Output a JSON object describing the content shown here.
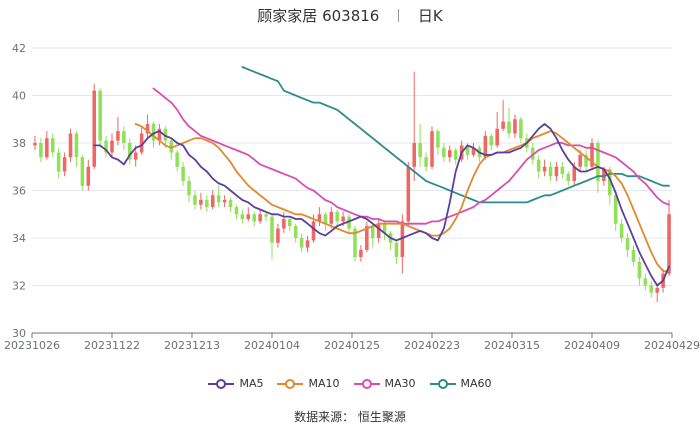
{
  "header": {
    "name": "顾家家居",
    "code": "603816",
    "period": "日K"
  },
  "source": "数据来源： 恒生聚源",
  "colors": {
    "up": "#ee6666",
    "down": "#91e158",
    "grid": "#e4e7ee",
    "axis": "#6e7079"
  },
  "chart_data": {
    "type": "candlestick",
    "ylim": [
      30,
      42
    ],
    "yticks": [
      30,
      32,
      34,
      36,
      38,
      40,
      42
    ],
    "xticks": [
      "20231026",
      "20231122",
      "20231213",
      "20240104",
      "20240125",
      "20240223",
      "20240315",
      "20240409",
      "20240429"
    ],
    "legend": [
      {
        "name": "MA5",
        "color": "#5b3f9a"
      },
      {
        "name": "MA10",
        "color": "#e08a2e"
      },
      {
        "name": "MA30",
        "color": "#d84fb0"
      },
      {
        "name": "MA60",
        "color": "#2e8b8b"
      }
    ],
    "candles": [
      [
        37.9,
        38.0,
        38.3,
        37.7
      ],
      [
        38.0,
        37.4,
        38.2,
        37.2
      ],
      [
        37.4,
        38.2,
        38.5,
        37.3
      ],
      [
        38.2,
        37.6,
        38.4,
        37.4
      ],
      [
        37.6,
        36.8,
        37.8,
        36.5
      ],
      [
        36.8,
        37.4,
        37.6,
        36.6
      ],
      [
        37.4,
        38.4,
        38.6,
        37.2
      ],
      [
        38.4,
        37.4,
        38.5,
        37.0
      ],
      [
        37.4,
        36.2,
        37.5,
        36.0
      ],
      [
        36.2,
        37.0,
        37.3,
        36.0
      ],
      [
        37.0,
        40.2,
        40.5,
        36.9
      ],
      [
        40.2,
        38.1,
        40.3,
        37.8
      ],
      [
        38.1,
        37.6,
        38.3,
        37.4
      ],
      [
        37.6,
        38.1,
        38.4,
        37.4
      ],
      [
        38.1,
        38.5,
        39.1,
        37.9
      ],
      [
        38.5,
        38.0,
        38.7,
        37.7
      ],
      [
        38.0,
        37.3,
        38.2,
        37.1
      ],
      [
        37.3,
        37.6,
        37.9,
        37.0
      ],
      [
        37.6,
        38.4,
        38.7,
        37.5
      ],
      [
        38.4,
        38.8,
        39.2,
        38.2
      ],
      [
        38.8,
        38.1,
        38.9,
        37.8
      ],
      [
        38.1,
        38.6,
        38.8,
        37.9
      ],
      [
        38.6,
        38.1,
        38.7,
        37.8
      ],
      [
        38.1,
        37.6,
        38.2,
        37.3
      ],
      [
        37.6,
        37.0,
        37.7,
        36.8
      ],
      [
        37.0,
        36.4,
        37.2,
        36.2
      ],
      [
        36.4,
        35.8,
        36.6,
        35.5
      ],
      [
        35.8,
        35.4,
        36.0,
        35.2
      ],
      [
        35.4,
        35.6,
        35.9,
        35.2
      ],
      [
        35.6,
        35.3,
        35.8,
        35.1
      ],
      [
        35.3,
        35.8,
        36.0,
        35.2
      ],
      [
        35.8,
        35.5,
        36.2,
        35.3
      ],
      [
        35.5,
        35.6,
        35.8,
        35.3
      ],
      [
        35.6,
        35.3,
        35.7,
        35.1
      ],
      [
        35.3,
        35.0,
        35.4,
        34.8
      ],
      [
        35.0,
        34.8,
        35.2,
        34.6
      ],
      [
        34.8,
        35.0,
        35.3,
        34.7
      ],
      [
        35.0,
        34.7,
        35.1,
        34.5
      ],
      [
        34.7,
        35.0,
        35.2,
        34.6
      ],
      [
        35.0,
        34.9,
        35.1,
        34.7
      ],
      [
        34.9,
        33.8,
        35.0,
        33.1
      ],
      [
        33.8,
        34.4,
        34.6,
        33.6
      ],
      [
        34.4,
        34.8,
        35.1,
        34.2
      ],
      [
        34.8,
        34.5,
        34.9,
        34.3
      ],
      [
        34.5,
        34.0,
        34.6,
        33.8
      ],
      [
        34.0,
        33.6,
        34.2,
        33.4
      ],
      [
        33.6,
        33.9,
        34.1,
        33.4
      ],
      [
        33.9,
        34.7,
        35.0,
        33.8
      ],
      [
        34.7,
        35.0,
        35.3,
        34.5
      ],
      [
        35.0,
        34.6,
        35.1,
        34.3
      ],
      [
        34.6,
        35.1,
        35.3,
        34.4
      ],
      [
        35.1,
        34.7,
        35.2,
        34.5
      ],
      [
        34.7,
        34.9,
        35.1,
        34.5
      ],
      [
        34.9,
        34.4,
        35.0,
        34.2
      ],
      [
        34.4,
        33.2,
        34.5,
        33.0
      ],
      [
        33.2,
        33.5,
        33.7,
        33.0
      ],
      [
        33.5,
        34.5,
        34.7,
        33.4
      ],
      [
        34.5,
        34.0,
        34.6,
        33.6
      ],
      [
        34.0,
        34.6,
        34.8,
        33.8
      ],
      [
        34.6,
        34.2,
        34.7,
        33.9
      ],
      [
        34.2,
        33.8,
        34.3,
        33.5
      ],
      [
        33.8,
        33.2,
        33.9,
        32.9
      ],
      [
        33.2,
        34.7,
        35.0,
        32.5
      ],
      [
        34.7,
        37.0,
        37.2,
        34.5
      ],
      [
        37.0,
        38.0,
        41.0,
        36.4
      ],
      [
        38.0,
        37.4,
        38.8,
        37.0
      ],
      [
        37.4,
        37.0,
        37.6,
        36.8
      ],
      [
        37.0,
        38.5,
        38.7,
        36.9
      ],
      [
        38.5,
        37.8,
        38.6,
        37.5
      ],
      [
        37.8,
        37.4,
        38.0,
        37.2
      ],
      [
        37.4,
        37.7,
        37.9,
        37.2
      ],
      [
        37.7,
        37.3,
        37.8,
        37.1
      ],
      [
        37.3,
        37.9,
        38.1,
        37.2
      ],
      [
        37.9,
        37.5,
        38.0,
        37.3
      ],
      [
        37.5,
        37.8,
        38.0,
        37.4
      ],
      [
        37.8,
        37.4,
        37.9,
        37.2
      ],
      [
        37.4,
        38.3,
        38.5,
        37.3
      ],
      [
        38.3,
        37.9,
        38.4,
        37.7
      ],
      [
        37.9,
        38.6,
        39.3,
        37.8
      ],
      [
        38.6,
        38.9,
        39.8,
        38.5
      ],
      [
        38.9,
        38.4,
        39.5,
        38.2
      ],
      [
        38.4,
        39.0,
        39.2,
        38.2
      ],
      [
        39.0,
        38.2,
        39.1,
        38.0
      ],
      [
        38.2,
        37.8,
        38.4,
        37.6
      ],
      [
        37.8,
        37.3,
        38.0,
        37.1
      ],
      [
        37.3,
        36.8,
        37.5,
        36.5
      ],
      [
        36.8,
        37.0,
        37.3,
        36.6
      ],
      [
        37.0,
        36.6,
        37.2,
        36.4
      ],
      [
        36.6,
        37.0,
        37.2,
        36.4
      ],
      [
        37.0,
        36.7,
        37.2,
        36.5
      ],
      [
        36.7,
        36.4,
        36.8,
        36.2
      ],
      [
        36.4,
        37.0,
        37.2,
        36.2
      ],
      [
        37.0,
        37.5,
        37.7,
        36.8
      ],
      [
        37.5,
        37.0,
        37.7,
        36.8
      ],
      [
        37.0,
        38.0,
        38.2,
        36.9
      ],
      [
        38.0,
        36.4,
        38.1,
        35.9
      ],
      [
        36.4,
        36.9,
        37.0,
        36.2
      ],
      [
        36.9,
        35.8,
        37.0,
        35.4
      ],
      [
        35.8,
        34.6,
        36.0,
        34.3
      ],
      [
        34.6,
        34.0,
        34.8,
        33.8
      ],
      [
        34.0,
        33.5,
        34.2,
        33.2
      ],
      [
        33.5,
        33.0,
        33.7,
        32.8
      ],
      [
        33.0,
        32.3,
        33.2,
        32.0
      ],
      [
        32.3,
        32.0,
        32.5,
        31.8
      ],
      [
        32.0,
        31.7,
        32.2,
        31.5
      ],
      [
        31.7,
        31.9,
        32.1,
        31.3
      ],
      [
        31.9,
        32.5,
        32.7,
        31.7
      ],
      [
        32.5,
        35.0,
        35.6,
        32.4
      ]
    ],
    "ma5": [
      37.9,
      37.9,
      37.7,
      37.4,
      37.3,
      37.1,
      37.5,
      37.8,
      37.9,
      38.2,
      38.4,
      38.5,
      38.3,
      38.2,
      38.0,
      37.9,
      37.5,
      37.3,
      37.0,
      36.8,
      36.5,
      36.3,
      36.2,
      36.0,
      35.8,
      35.6,
      35.5,
      35.3,
      35.2,
      35.1,
      35.0,
      35.0,
      34.9,
      34.9,
      34.8,
      34.8,
      34.6,
      34.4,
      34.2,
      34.1,
      34.3,
      34.5,
      34.6,
      34.7,
      34.8,
      34.9,
      34.8,
      34.6,
      34.4,
      34.2,
      34.0,
      33.9,
      34.0,
      34.1,
      34.2,
      34.3,
      34.2,
      34.0,
      33.9,
      34.4,
      35.5,
      36.8,
      37.6,
      37.9,
      37.8,
      37.6,
      37.5,
      37.5,
      37.6,
      37.6,
      37.6,
      37.7,
      37.8,
      38.0,
      38.3,
      38.6,
      38.8,
      38.6,
      38.2,
      37.7,
      37.3,
      37.0,
      36.8,
      36.8,
      36.9,
      37.0,
      36.9,
      36.5,
      35.9,
      35.2,
      34.6,
      34.0,
      33.4,
      32.9,
      32.4,
      32.0,
      32.2,
      32.8
    ],
    "ma10": [
      38.8,
      38.7,
      38.5,
      38.3,
      38.1,
      37.9,
      37.8,
      37.9,
      38.0,
      38.1,
      38.2,
      38.2,
      38.1,
      38.0,
      37.8,
      37.5,
      37.2,
      36.8,
      36.5,
      36.2,
      36.0,
      35.8,
      35.6,
      35.4,
      35.3,
      35.2,
      35.1,
      35.0,
      35.0,
      34.9,
      34.8,
      34.7,
      34.6,
      34.5,
      34.4,
      34.3,
      34.2,
      34.2,
      34.3,
      34.4,
      34.5,
      34.6,
      34.6,
      34.6,
      34.6,
      34.6,
      34.5,
      34.4,
      34.3,
      34.2,
      34.1,
      34.1,
      34.2,
      34.4,
      34.8,
      35.3,
      36.0,
      36.6,
      37.1,
      37.4,
      37.5,
      37.6,
      37.6,
      37.7,
      37.8,
      37.9,
      38.0,
      38.2,
      38.3,
      38.4,
      38.5,
      38.4,
      38.2,
      38.0,
      37.8,
      37.6,
      37.4,
      37.2,
      37.0,
      36.9,
      36.8,
      36.6,
      36.3,
      35.8,
      35.2,
      34.6,
      34.0,
      33.4,
      32.9,
      32.6,
      32.6
    ],
    "ma30": [
      40.3,
      40.1,
      39.9,
      39.7,
      39.4,
      39.0,
      38.7,
      38.5,
      38.3,
      38.2,
      38.1,
      38.0,
      37.9,
      37.8,
      37.7,
      37.6,
      37.5,
      37.3,
      37.1,
      37.0,
      36.9,
      36.8,
      36.7,
      36.6,
      36.5,
      36.3,
      36.1,
      36.0,
      35.8,
      35.6,
      35.5,
      35.3,
      35.2,
      35.1,
      35.0,
      34.9,
      34.9,
      34.8,
      34.8,
      34.7,
      34.7,
      34.7,
      34.6,
      34.6,
      34.6,
      34.6,
      34.6,
      34.7,
      34.7,
      34.8,
      34.9,
      35.0,
      35.1,
      35.2,
      35.3,
      35.5,
      35.6,
      35.8,
      36.0,
      36.2,
      36.4,
      36.7,
      37.0,
      37.3,
      37.5,
      37.7,
      37.8,
      37.9,
      38.0,
      38.0,
      37.9,
      37.9,
      37.9,
      37.8,
      37.8,
      37.7,
      37.6,
      37.5,
      37.4,
      37.2,
      37.0,
      36.8,
      36.5,
      36.3,
      36.0,
      35.7,
      35.5,
      35.4
    ],
    "ma60": [
      41.2,
      41.1,
      41.0,
      40.9,
      40.8,
      40.7,
      40.6,
      40.2,
      40.1,
      40.0,
      39.9,
      39.8,
      39.7,
      39.7,
      39.6,
      39.5,
      39.4,
      39.2,
      39.0,
      38.8,
      38.6,
      38.4,
      38.2,
      38.0,
      37.8,
      37.6,
      37.4,
      37.2,
      37.0,
      36.8,
      36.6,
      36.4,
      36.3,
      36.2,
      36.1,
      36.0,
      35.9,
      35.8,
      35.7,
      35.6,
      35.5,
      35.5,
      35.5,
      35.5,
      35.5,
      35.5,
      35.5,
      35.5,
      35.5,
      35.6,
      35.7,
      35.8,
      35.8,
      35.9,
      36.0,
      36.1,
      36.2,
      36.3,
      36.4,
      36.5,
      36.6,
      36.6,
      36.7,
      36.7,
      36.7,
      36.6,
      36.6,
      36.6,
      36.5,
      36.4,
      36.3,
      36.2,
      36.2
    ]
  }
}
